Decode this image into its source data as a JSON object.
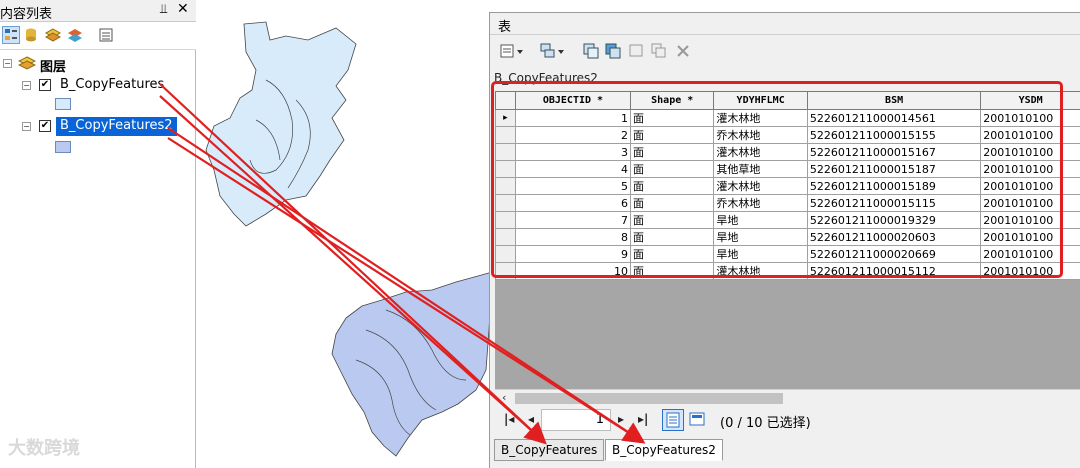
{
  "toc": {
    "title": "内容列表",
    "root_label": "图层",
    "layers": [
      {
        "name": "B_CopyFeatures",
        "checked": true,
        "selected": false,
        "fill": "#d6ebfa"
      },
      {
        "name": "B_CopyFeatures2",
        "checked": true,
        "selected": true,
        "fill": "#b9c9ef"
      }
    ]
  },
  "table_window": {
    "title": "表",
    "table_name": "B_CopyFeatures2",
    "columns": [
      "OBJECTID *",
      "Shape *",
      "YDYHFLMC",
      "BSM",
      "YSDM"
    ],
    "rows": [
      {
        "id": "1",
        "shape": "面",
        "type": "灌木林地",
        "bsm": "522601211000014561",
        "ysdm": "2001010100"
      },
      {
        "id": "2",
        "shape": "面",
        "type": "乔木林地",
        "bsm": "522601211000015155",
        "ysdm": "2001010100"
      },
      {
        "id": "3",
        "shape": "面",
        "type": "灌木林地",
        "bsm": "522601211000015167",
        "ysdm": "2001010100"
      },
      {
        "id": "4",
        "shape": "面",
        "type": "其他草地",
        "bsm": "522601211000015187",
        "ysdm": "2001010100"
      },
      {
        "id": "5",
        "shape": "面",
        "type": "灌木林地",
        "bsm": "522601211000015189",
        "ysdm": "2001010100"
      },
      {
        "id": "6",
        "shape": "面",
        "type": "乔木林地",
        "bsm": "522601211000015115",
        "ysdm": "2001010100"
      },
      {
        "id": "7",
        "shape": "面",
        "type": "旱地",
        "bsm": "522601211000019329",
        "ysdm": "2001010100"
      },
      {
        "id": "8",
        "shape": "面",
        "type": "旱地",
        "bsm": "522601211000020603",
        "ysdm": "2001010100"
      },
      {
        "id": "9",
        "shape": "面",
        "type": "旱地",
        "bsm": "522601211000020669",
        "ysdm": "2001010100"
      },
      {
        "id": "10",
        "shape": "面",
        "type": "灌木林地",
        "bsm": "522601211000015112",
        "ysdm": "2001010100"
      }
    ],
    "current_record": "1",
    "selection_status": "(0 / 10 已选择)",
    "tabs": [
      "B_CopyFeatures",
      "B_CopyFeatures2"
    ],
    "active_tab": 1
  },
  "watermark": "大数跨境",
  "colors": {
    "highlight": "#e02020",
    "selection": "#0a64d6"
  }
}
